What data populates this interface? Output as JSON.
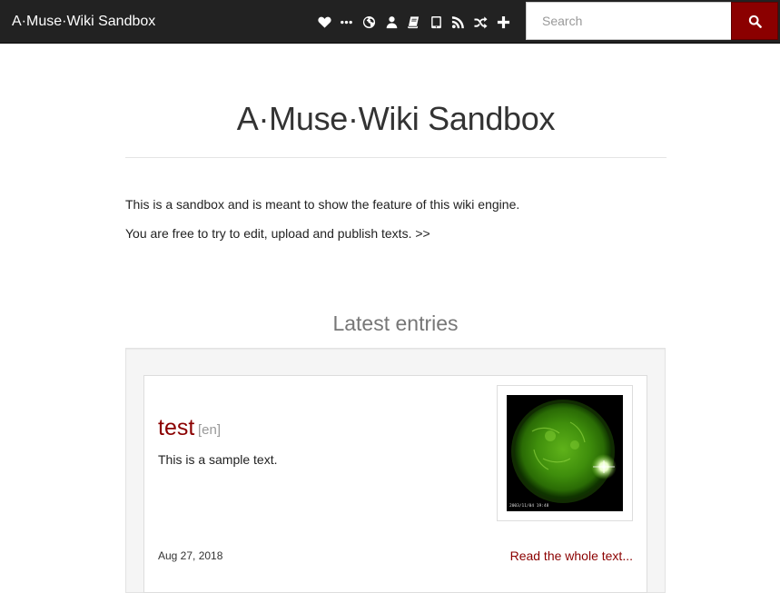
{
  "navbar": {
    "brand": "A·Muse·Wiki Sandbox",
    "icons": [
      "heart-icon",
      "ellipsis-icon",
      "globe-icon",
      "user-icon",
      "books-icon",
      "tablet-icon",
      "rss-icon",
      "random-icon",
      "plus-icon"
    ],
    "search": {
      "placeholder": "Search",
      "value": "",
      "button_icon": "search-icon"
    }
  },
  "header": {
    "title": "A·Muse·Wiki Sandbox"
  },
  "intro": {
    "line1": "This is a sandbox and is meant to show the feature of this wiki engine.",
    "line2": "You are free to try to edit, upload and publish texts. >>"
  },
  "latest": {
    "title": "Latest entries",
    "entries": [
      {
        "title": "test",
        "lang": "[en]",
        "description": "This is a sample text.",
        "thumb_caption": "2003/11/04 19:48",
        "date": "Aug 27, 2018",
        "read_more": "Read the whole text..."
      }
    ]
  },
  "colors": {
    "navbar_bg": "#222222",
    "accent": "#8b0000",
    "well_bg": "#f5f5f5"
  }
}
